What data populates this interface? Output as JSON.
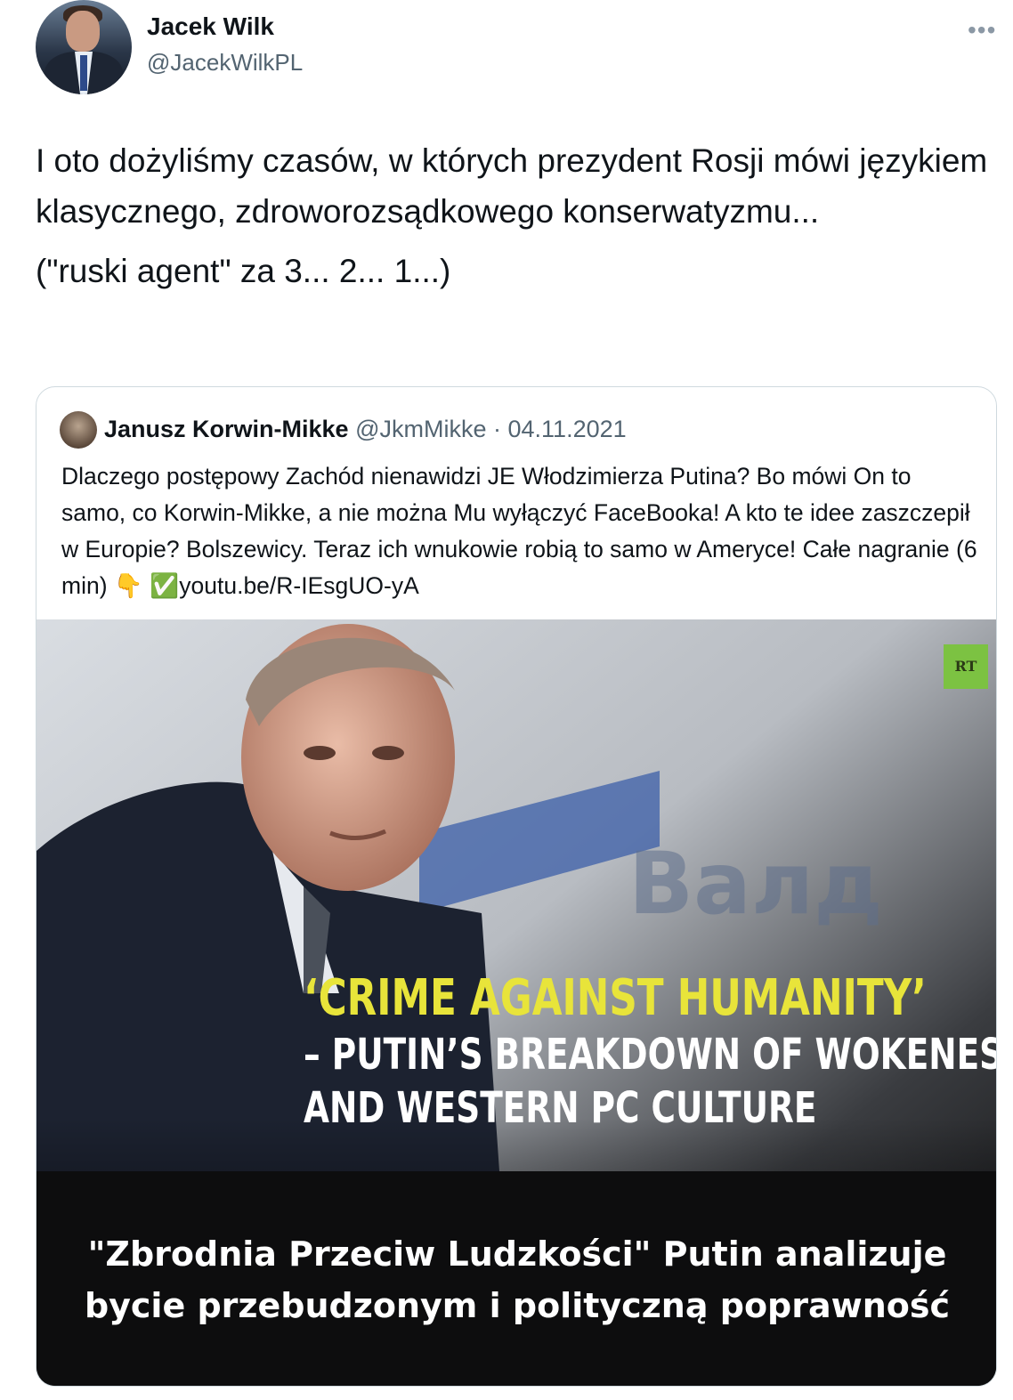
{
  "author": {
    "name": "Jacek Wilk",
    "handle": "@JacekWilkPL"
  },
  "menu_icon": "more-horizontal-icon",
  "tweet": {
    "paragraph1": "I oto dożyliśmy czasów, w których prezydent Rosji mówi językiem klasycznego, zdroworozsądkowego konserwatyzmu...",
    "paragraph2": "(\"ruski agent\" za 3... 2... 1...)"
  },
  "quoted": {
    "name": "Janusz Korwin-Mikke",
    "handle": "@JkmMikke",
    "separator": "·",
    "date": "04.11.2021",
    "text": "Dlaczego postępowy Zachód nienawidzi JE Włodzimierza Putina? Bo mówi On to samo, co Korwin-Mikke, a nie można Mu wyłączyć FaceBooka! A kto te idee zaszczepił w Europie? Bolszewicy. Teraz ich wnukowie robią to samo w Ameryce! Całe nagranie (6 min) 👇 ✅",
    "link": "youtu.be/R-IEsgUO-yA"
  },
  "media": {
    "logo": "RT",
    "background_sign": "Валд",
    "headline_line1": "‘CRIME AGAINST HUMANITY’",
    "headline_line2": "– PUTIN’S BREAKDOWN OF WOKENESS",
    "headline_line3": "AND WESTERN PC CULTURE",
    "caption_line1": "\"Zbrodnia Przeciw Ludzkości\" Putin analizuje",
    "caption_line2": "bycie przebudzonym i polityczną poprawność",
    "colors": {
      "headline_accent": "#e8e43a",
      "logo_bg": "#7cc242"
    }
  }
}
